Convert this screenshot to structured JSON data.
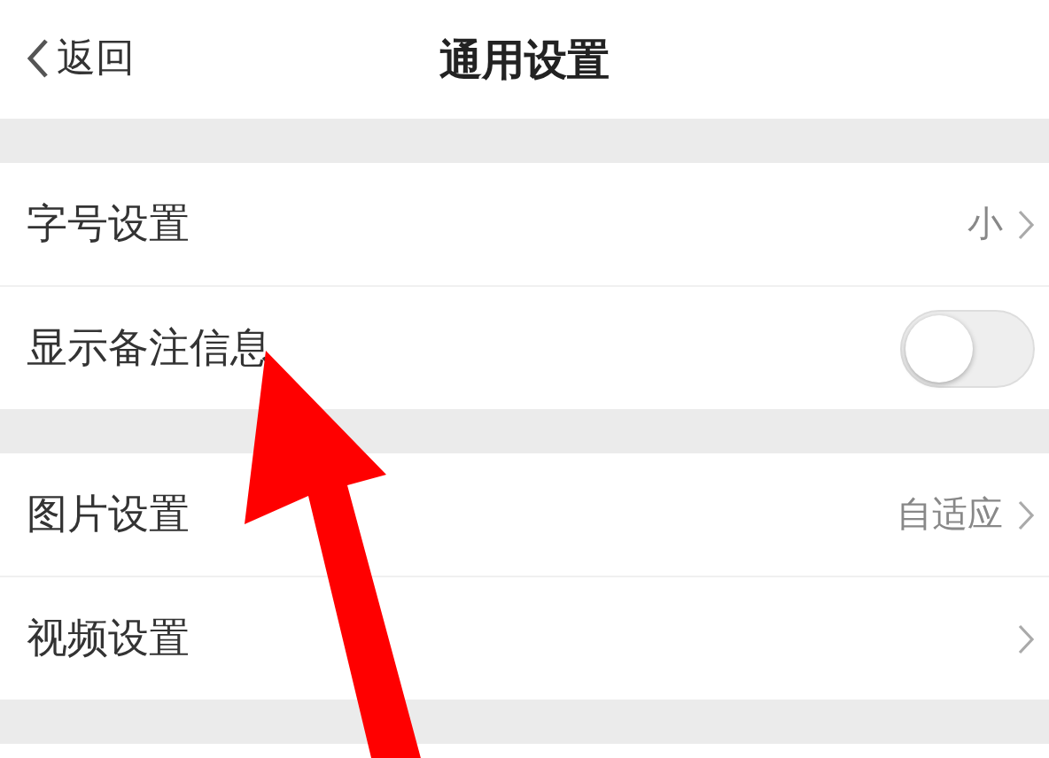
{
  "nav_bar": {
    "back_label": "返回",
    "title": "通用设置"
  },
  "sections": [
    {
      "rows": [
        {
          "kind": "value",
          "label": "字号设置",
          "value": "小"
        },
        {
          "kind": "toggle",
          "label": "显示备注信息",
          "on": false
        }
      ]
    },
    {
      "rows": [
        {
          "kind": "value",
          "label": "图片设置",
          "value": "自适应"
        },
        {
          "kind": "value",
          "label": "视频设置"
        }
      ]
    }
  ]
}
